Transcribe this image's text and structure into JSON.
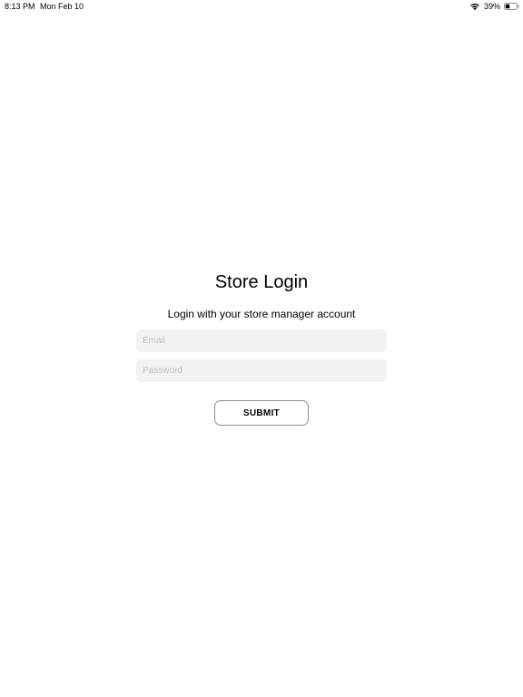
{
  "status_bar": {
    "time": "8:13 PM",
    "date": "Mon Feb 10",
    "battery_percent": "39%",
    "battery_level": 0.39,
    "wifi_icon": "wifi-icon",
    "battery_icon": "battery-icon"
  },
  "login": {
    "title": "Store Login",
    "subtitle": "Login with your store manager account",
    "email_placeholder": "Email",
    "email_value": "",
    "password_placeholder": "Password",
    "password_value": "",
    "submit_label": "SUBMIT"
  },
  "colors": {
    "background": "#ffffff",
    "field_background": "#f2f2f4",
    "placeholder": "#c0c0c6",
    "button_border": "#8e8e93",
    "text": "#000000"
  }
}
